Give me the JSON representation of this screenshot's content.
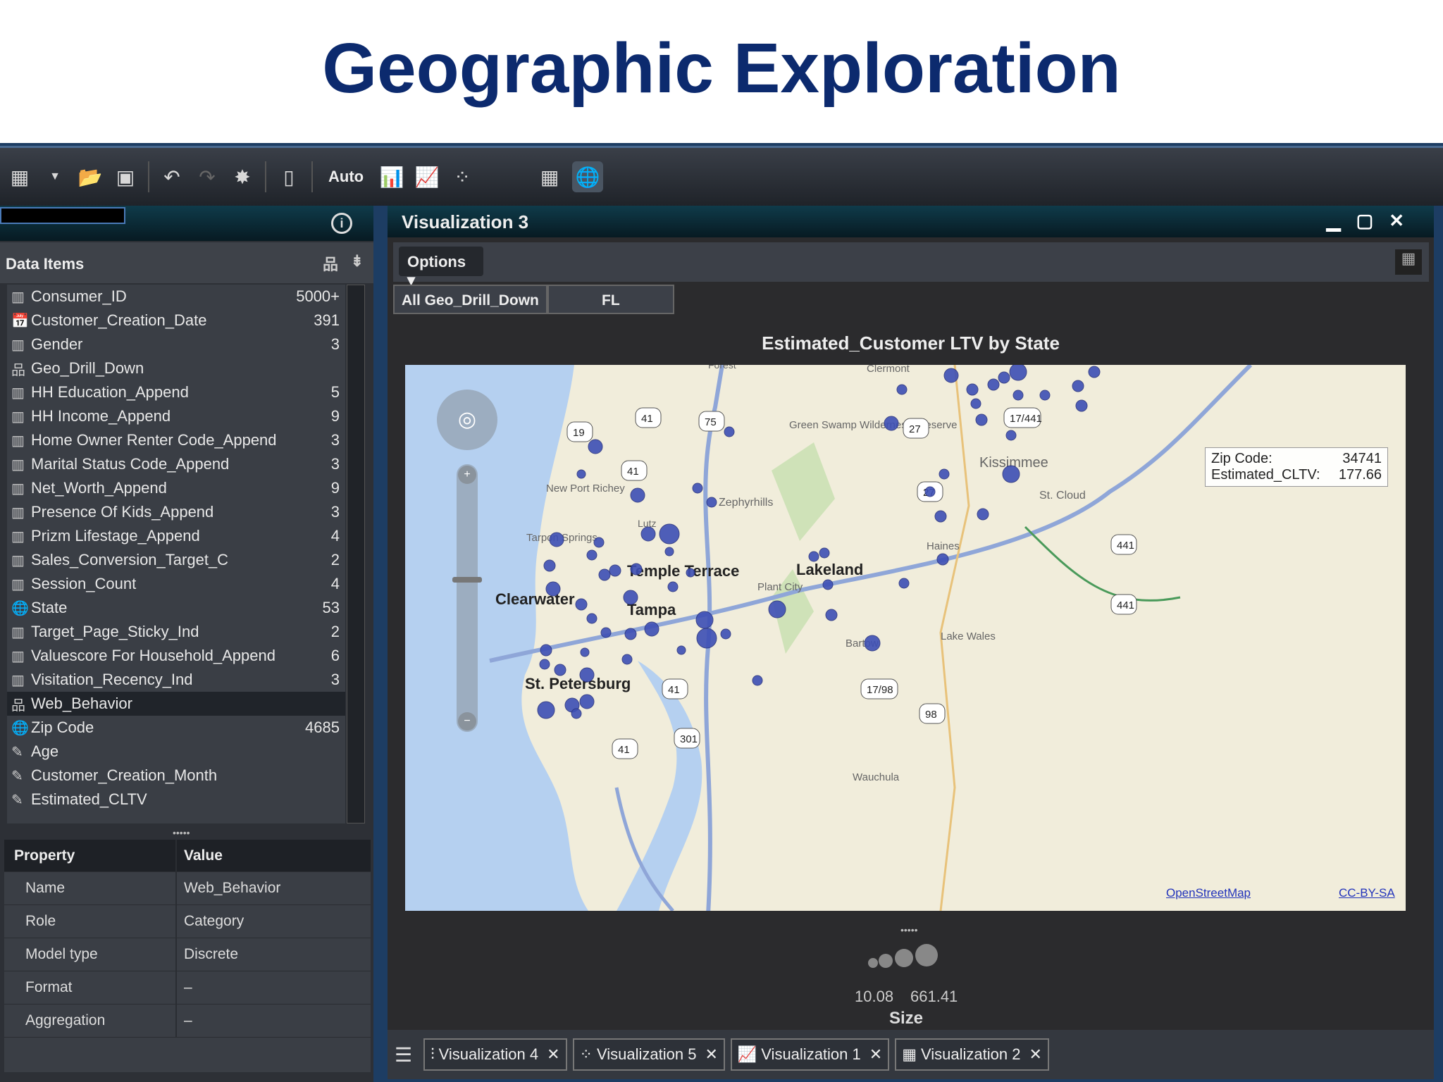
{
  "slide_title": "Geographic Exploration",
  "toolbar": {
    "auto_label": "Auto"
  },
  "left_panel": {
    "data_items_title": "Data Items",
    "items": [
      {
        "icon": "measure-icon",
        "label": "Consumer_ID",
        "count": "5000+"
      },
      {
        "icon": "date-icon",
        "label": "Customer_Creation_Date",
        "count": "391"
      },
      {
        "icon": "measure-icon",
        "label": "Gender",
        "count": "3"
      },
      {
        "icon": "hierarchy-icon",
        "label": "Geo_Drill_Down",
        "count": ""
      },
      {
        "icon": "measure-icon",
        "label": "HH Education_Append",
        "count": "5"
      },
      {
        "icon": "measure-icon",
        "label": "HH Income_Append",
        "count": "9"
      },
      {
        "icon": "measure-icon",
        "label": "Home Owner Renter Code_Append",
        "count": "3"
      },
      {
        "icon": "measure-icon",
        "label": "Marital Status Code_Append",
        "count": "3"
      },
      {
        "icon": "measure-icon",
        "label": "Net_Worth_Append",
        "count": "9"
      },
      {
        "icon": "measure-icon",
        "label": "Presence Of Kids_Append",
        "count": "3"
      },
      {
        "icon": "measure-icon",
        "label": "Prizm Lifestage_Append",
        "count": "4"
      },
      {
        "icon": "measure-icon",
        "label": "Sales_Conversion_Target_C",
        "count": "2"
      },
      {
        "icon": "measure-icon",
        "label": "Session_Count",
        "count": "4"
      },
      {
        "icon": "geo-icon",
        "label": "State",
        "count": "53"
      },
      {
        "icon": "measure-icon",
        "label": "Target_Page_Sticky_Ind",
        "count": "2"
      },
      {
        "icon": "measure-icon",
        "label": "Valuescore For Household_Append",
        "count": "6"
      },
      {
        "icon": "measure-icon",
        "label": "Visitation_Recency_Ind",
        "count": "3"
      },
      {
        "icon": "hierarchy-icon",
        "label": "Web_Behavior",
        "count": "",
        "selected": true
      },
      {
        "icon": "geo-icon",
        "label": "Zip Code",
        "count": "4685"
      },
      {
        "icon": "ruler-icon",
        "label": "Age",
        "count": ""
      },
      {
        "icon": "ruler-icon",
        "label": "Customer_Creation_Month",
        "count": ""
      },
      {
        "icon": "ruler-icon",
        "label": "Estimated_CLTV",
        "count": ""
      }
    ],
    "properties": {
      "header": [
        "Property",
        "Value"
      ],
      "rows": [
        [
          "Name",
          "Web_Behavior"
        ],
        [
          "Role",
          "Category"
        ],
        [
          "Model type",
          "Discrete"
        ],
        [
          "Format",
          "–"
        ],
        [
          "Aggregation",
          "–"
        ]
      ]
    }
  },
  "visualization": {
    "title": "Visualization 3",
    "options_label": "Options",
    "breadcrumbs": [
      "All Geo_Drill_Down",
      "FL"
    ],
    "chart_title": "Estimated_Customer LTV by State",
    "map_labels": [
      "Clearwater",
      "Tampa",
      "Temple Terrace",
      "Lakeland",
      "St. Petersburg",
      "Kissimmee",
      "St. Cloud",
      "Zephyrhills",
      "New Port Richey",
      "Tarpon Springs",
      "Lutz",
      "Haines",
      "Lake Wales",
      "Bartow",
      "Plant City",
      "Clermont",
      "Wauchula",
      "Green Swamp Wilderness Preserve",
      "Forest"
    ],
    "road_shields": [
      "41",
      "75",
      "19",
      "41",
      "27",
      "27",
      "17/441",
      "441",
      "441",
      "17/98",
      "98",
      "41",
      "301",
      "41"
    ],
    "tooltip": {
      "zip_label": "Zip Code:",
      "zip_value": "34741",
      "cltv_label": "Estimated_CLTV:",
      "cltv_value": "177.66"
    },
    "attribution": {
      "osm": "OpenStreetMap",
      "license": "CC-BY-SA"
    },
    "legend": {
      "min": "10.08",
      "max": "661.41",
      "title": "Size"
    }
  },
  "tabs": [
    "Visualization 4",
    "Visualization 5",
    "Visualization 1",
    "Visualization 2"
  ],
  "colors": {
    "title": "#0c2a6e",
    "bubble": "#3d4fb5"
  }
}
